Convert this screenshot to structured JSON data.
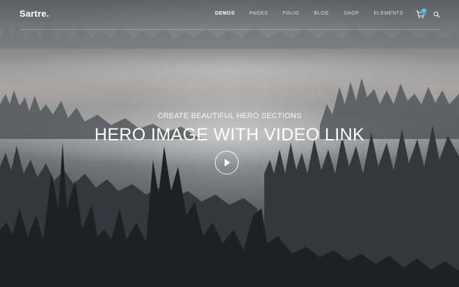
{
  "brand": {
    "logo_text": "Sartre."
  },
  "nav": {
    "items": [
      {
        "label": "DEMOS",
        "active": true
      },
      {
        "label": "PAGES",
        "active": false
      },
      {
        "label": "FOLIO",
        "active": false
      },
      {
        "label": "BLOG",
        "active": false
      },
      {
        "label": "SHOP",
        "active": false
      },
      {
        "label": "ELEMENTS",
        "active": false
      }
    ],
    "cart_count": "0",
    "cart_icon": "shopping-cart-icon",
    "search_icon": "search-icon"
  },
  "hero": {
    "kicker": "CREATE BEAUTIFUL HERO SECTIONS",
    "title": "HERO IMAGE WITH VIDEO LINK",
    "play_icon": "play-icon",
    "accent_color": "#3ea6d9"
  }
}
